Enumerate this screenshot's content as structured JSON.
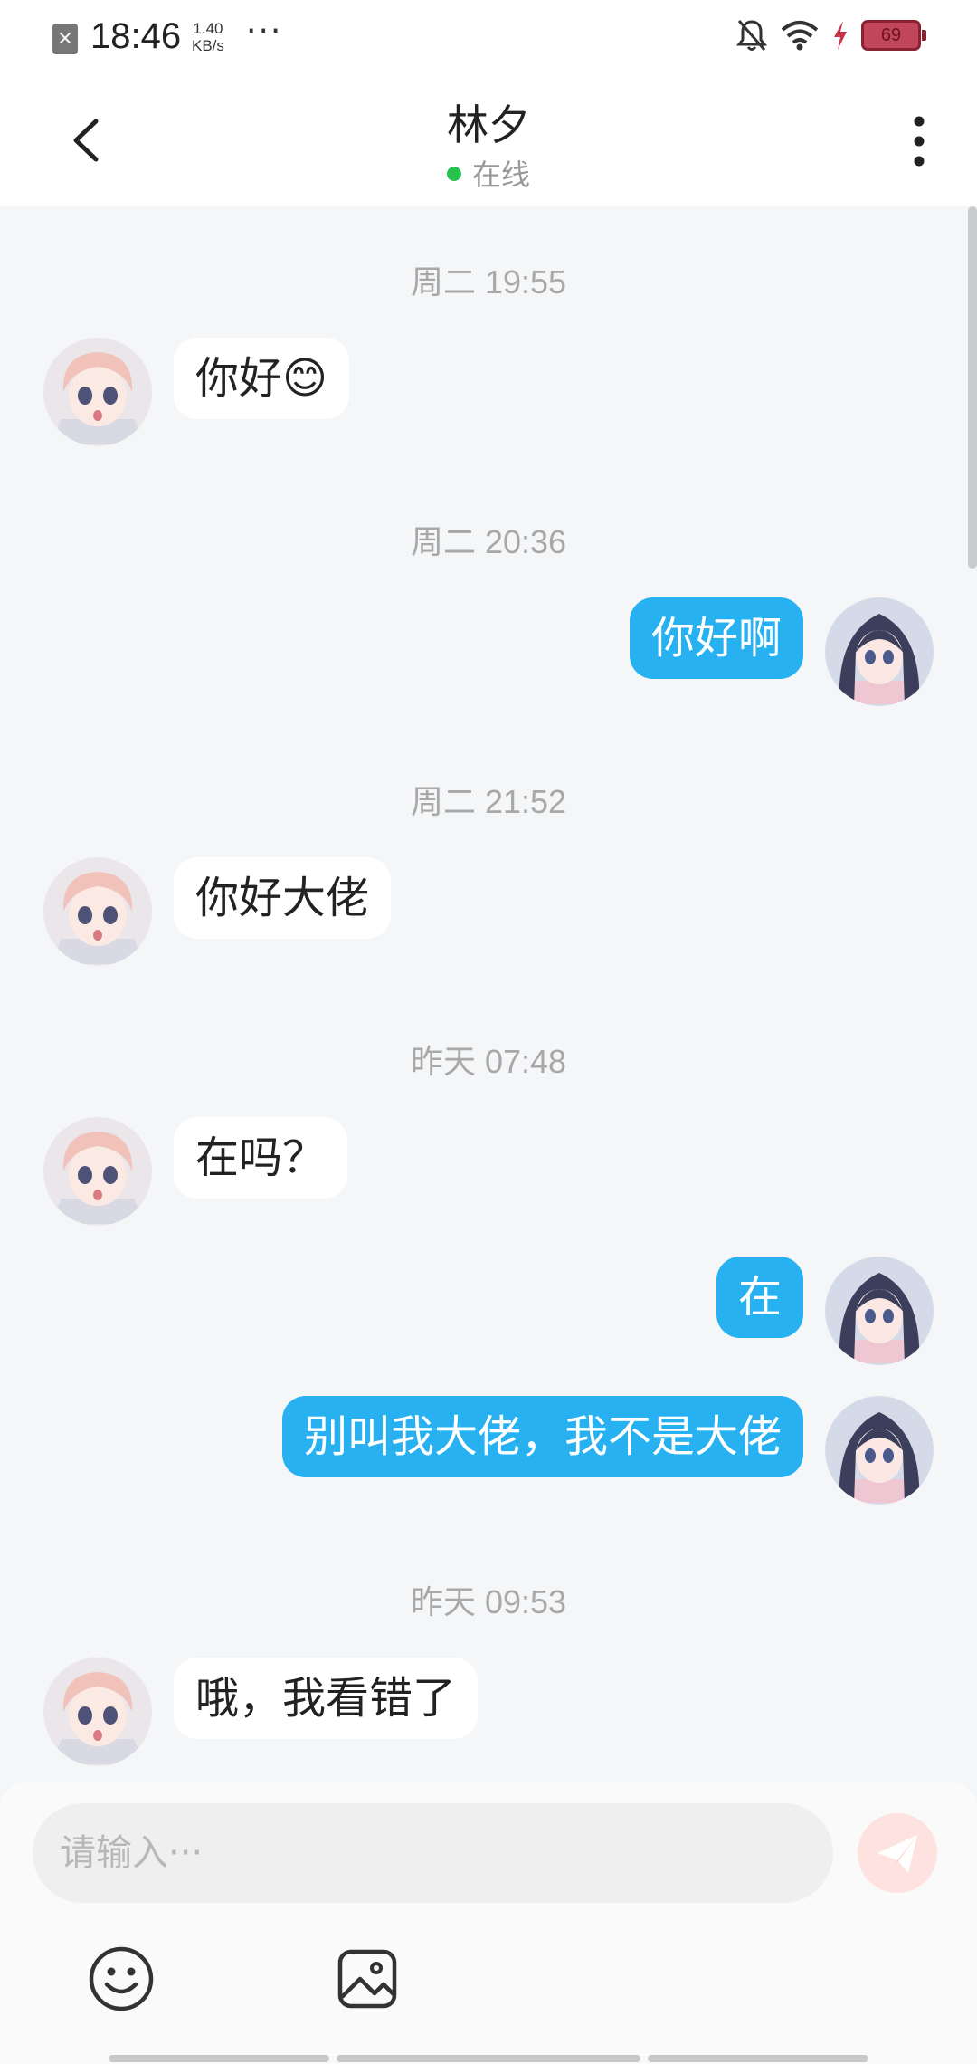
{
  "status_bar": {
    "time": "18:46",
    "speed_value": "1.40",
    "speed_unit": "KB/s",
    "dots": "···",
    "battery": "69"
  },
  "header": {
    "title": "林夕",
    "status": "在线"
  },
  "messages": [
    {
      "kind": "timestamp",
      "text": "周二 19:55"
    },
    {
      "kind": "incoming",
      "text": "你好😊"
    },
    {
      "kind": "timestamp",
      "text": "周二 20:36"
    },
    {
      "kind": "outgoing",
      "text": "你好啊"
    },
    {
      "kind": "timestamp",
      "text": "周二 21:52"
    },
    {
      "kind": "incoming",
      "text": "你好大佬"
    },
    {
      "kind": "timestamp",
      "text": "昨天 07:48"
    },
    {
      "kind": "incoming",
      "text": "在吗？"
    },
    {
      "kind": "outgoing",
      "text": "在"
    },
    {
      "kind": "outgoing",
      "text": "别叫我大佬，我不是大佬"
    },
    {
      "kind": "timestamp",
      "text": "昨天 09:53"
    },
    {
      "kind": "incoming",
      "text": "哦，我看错了"
    }
  ],
  "input": {
    "placeholder": "请输入···",
    "value": ""
  },
  "colors": {
    "outgoing_bubble": "#27b1f1",
    "online_dot": "#29c14d",
    "send_button": "#fde2e0"
  },
  "icons": [
    "back-arrow-icon",
    "more-vertical-icon",
    "send-icon",
    "emoji-icon",
    "image-icon"
  ]
}
